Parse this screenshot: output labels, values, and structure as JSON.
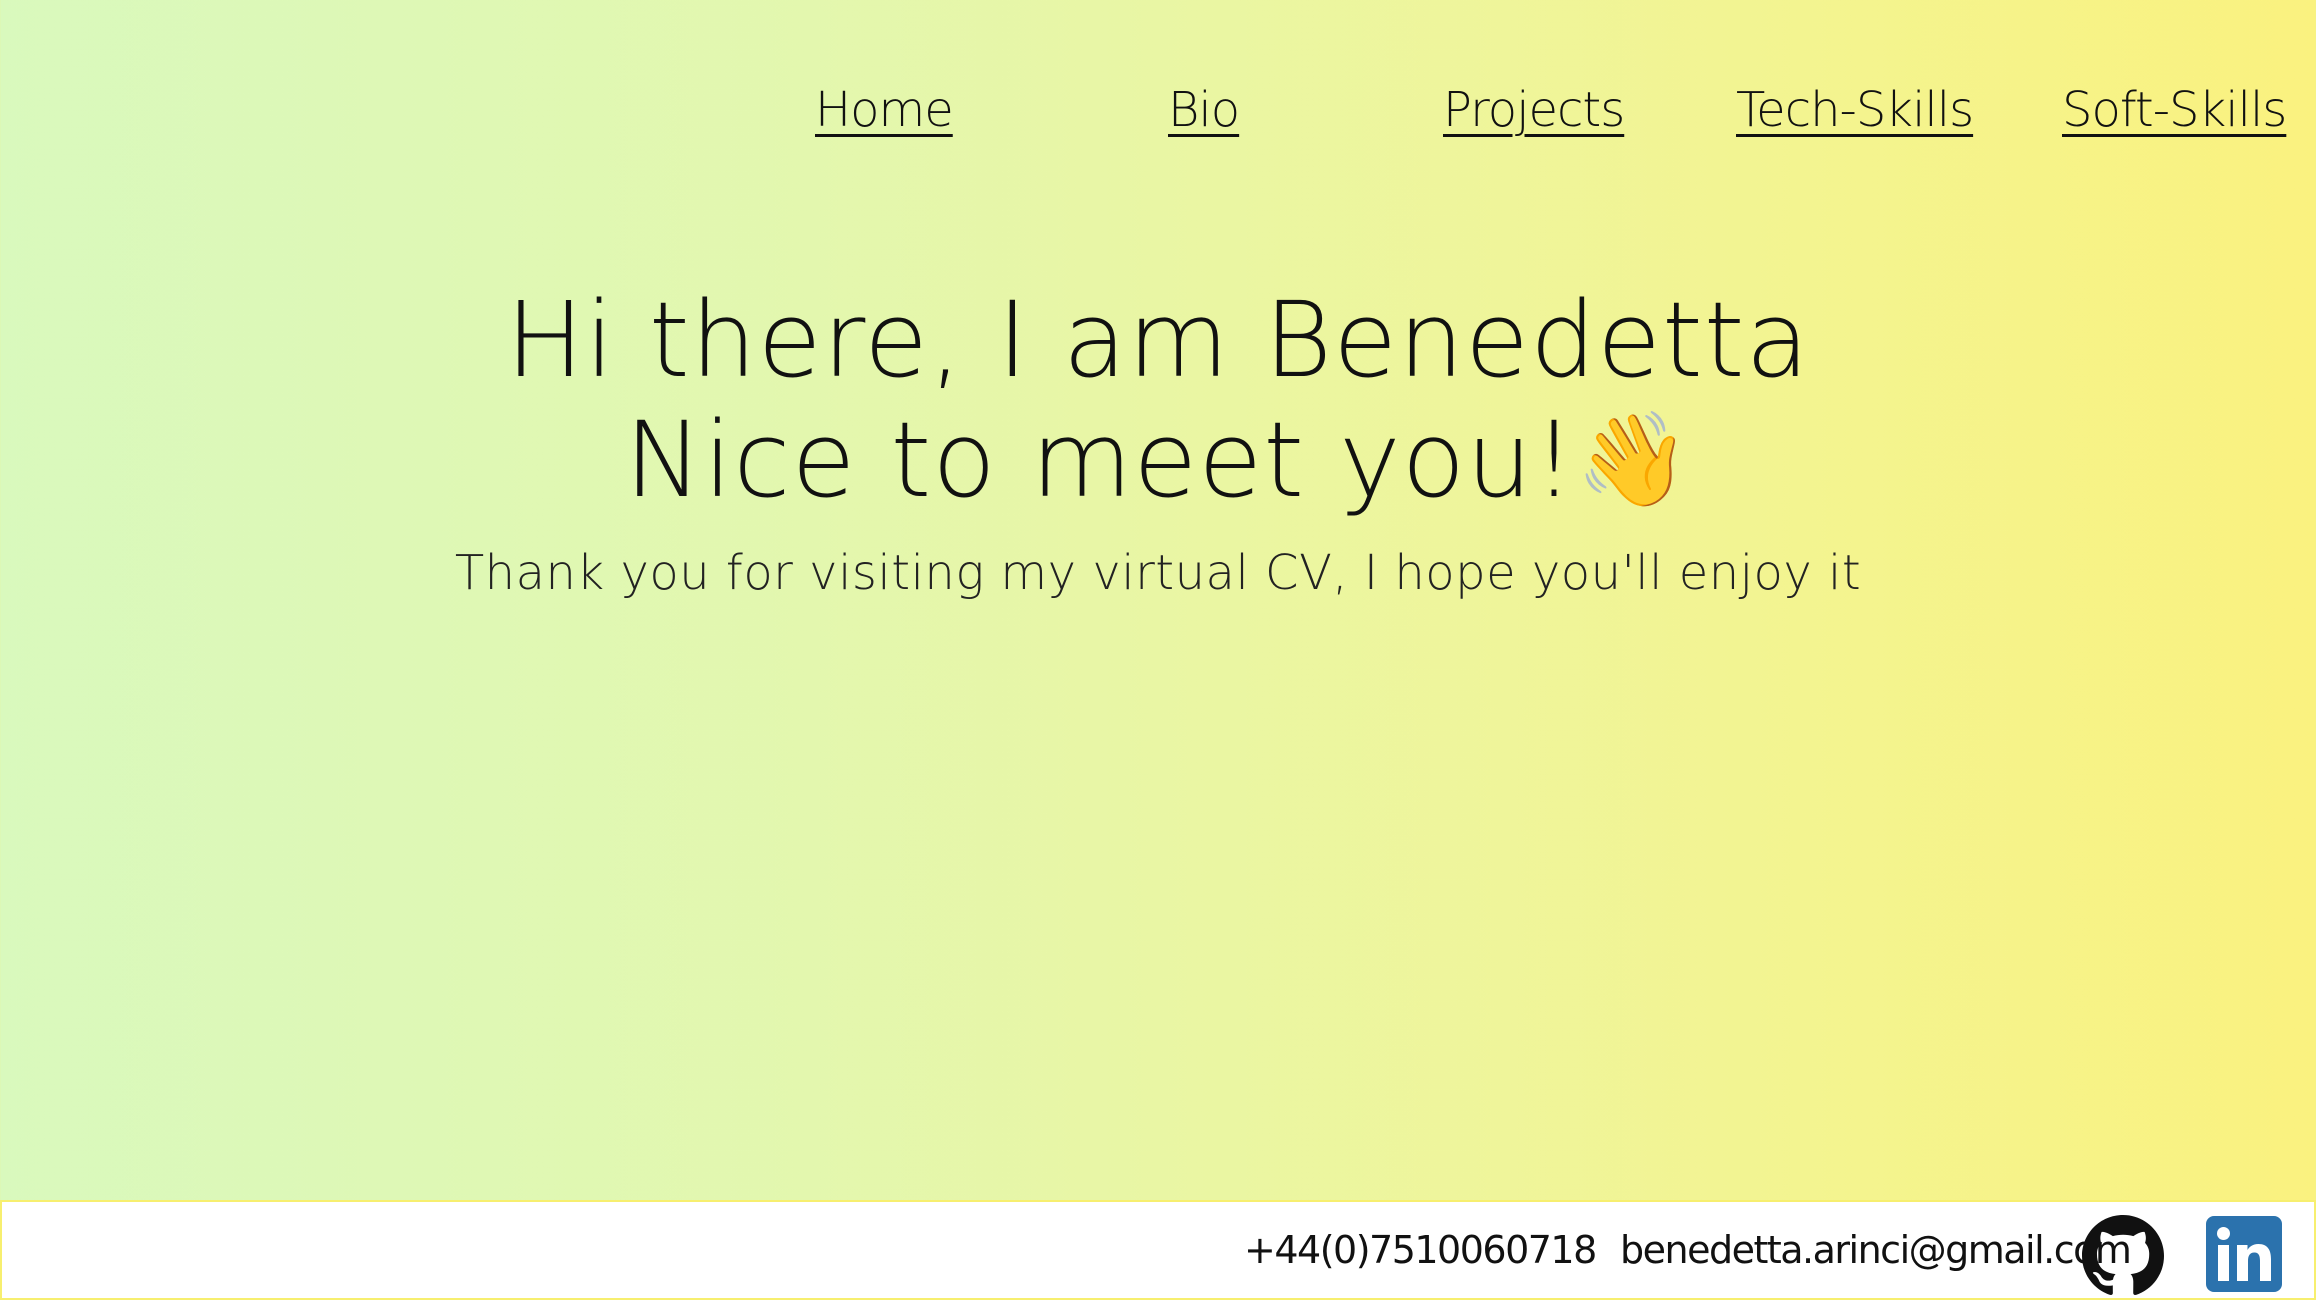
{
  "nav": {
    "items": [
      {
        "label": "Home"
      },
      {
        "label": "Bio"
      },
      {
        "label": "Projects"
      },
      {
        "label": "Tech-Skills"
      },
      {
        "label": "Soft-Skills"
      }
    ]
  },
  "hero": {
    "line1": "Hi there, I am Benedetta",
    "line2": "Nice to meet you!",
    "wave_emoji": "👋",
    "subtitle": "Thank you for visiting my virtual CV, I hope you'll enjoy it"
  },
  "footer": {
    "phone": "+44(0)7510060718",
    "email": "benedetta.arinci@gmail.com",
    "icons": [
      "github-icon",
      "linkedin-icon"
    ]
  },
  "colors": {
    "gradient_left": "#d9f9bd",
    "gradient_right": "#faf27f",
    "footer_border": "#f7ef6f",
    "linkedin_blue": "#2b72ad"
  }
}
